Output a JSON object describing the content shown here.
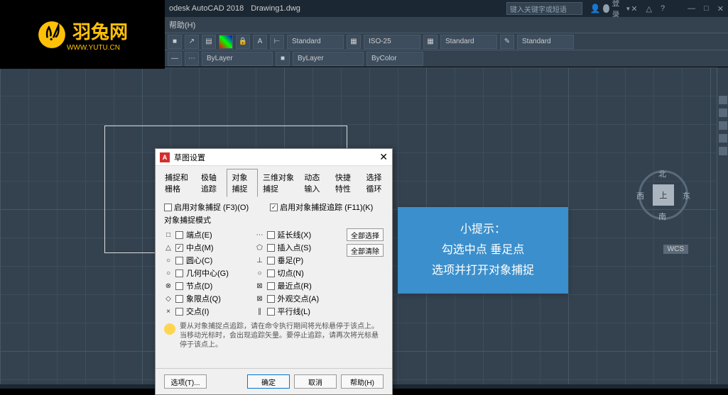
{
  "logo": {
    "text": "羽兔网",
    "sub": "WWW.YUTU.CN"
  },
  "titlebar": {
    "app": "odesk AutoCAD 2018",
    "file": "Drawing1.dwg",
    "search_placeholder": "键入关键字或短语",
    "login": "登录"
  },
  "menubar": {
    "help": "帮助(H)"
  },
  "toolbar": {
    "layer_combo": "ByLayer",
    "color_combo": "ByLayer",
    "ltype_combo": "ByColor",
    "std1": "Standard",
    "iso": "ISO-25",
    "std2": "Standard",
    "std3": "Standard"
  },
  "viewcube": {
    "n": "北",
    "s": "南",
    "e": "东",
    "w": "西",
    "top": "上",
    "wcs": "WCS"
  },
  "dialog": {
    "title": "草图设置",
    "tabs": [
      "捕捉和栅格",
      "极轴追踪",
      "对象捕捉",
      "三维对象捕捉",
      "动态输入",
      "快捷特性",
      "选择循环"
    ],
    "active_tab": 2,
    "enable_osnap": "启用对象捕捉 (F3)(O)",
    "enable_track": "启用对象捕捉追踪 (F11)(K)",
    "group_title": "对象捕捉模式",
    "left_items": [
      {
        "icon": "□",
        "label": "端点(E)",
        "checked": false
      },
      {
        "icon": "△",
        "label": "中点(M)",
        "checked": true
      },
      {
        "icon": "○",
        "label": "圆心(C)",
        "checked": false
      },
      {
        "icon": "○",
        "label": "几何中心(G)",
        "checked": false
      },
      {
        "icon": "⊗",
        "label": "节点(D)",
        "checked": false
      },
      {
        "icon": "◇",
        "label": "象限点(Q)",
        "checked": false
      },
      {
        "icon": "×",
        "label": "交点(I)",
        "checked": false
      }
    ],
    "right_items": [
      {
        "icon": "⋯",
        "label": "延长线(X)",
        "checked": false
      },
      {
        "icon": "⬠",
        "label": "插入点(S)",
        "checked": false
      },
      {
        "icon": "⊥",
        "label": "垂足(P)",
        "checked": false
      },
      {
        "icon": "○",
        "label": "切点(N)",
        "checked": false
      },
      {
        "icon": "⊠",
        "label": "最近点(R)",
        "checked": false
      },
      {
        "icon": "⊠",
        "label": "外观交点(A)",
        "checked": false
      },
      {
        "icon": "∥",
        "label": "平行线(L)",
        "checked": false
      }
    ],
    "select_all": "全部选择",
    "clear_all": "全部清除",
    "hint": "要从对象捕捉点追踪，请在命令执行期间将光标悬停于该点上。当移动光标时，会出现追踪矢量。要停止追踪，请再次将光标悬停于该点上。",
    "options_btn": "选项(T)...",
    "ok": "确定",
    "cancel": "取消",
    "help": "帮助(H)"
  },
  "tip": {
    "title": "小提示：",
    "line1": "勾选中点  垂足点",
    "line2": "选项并打开对象捕捉"
  }
}
